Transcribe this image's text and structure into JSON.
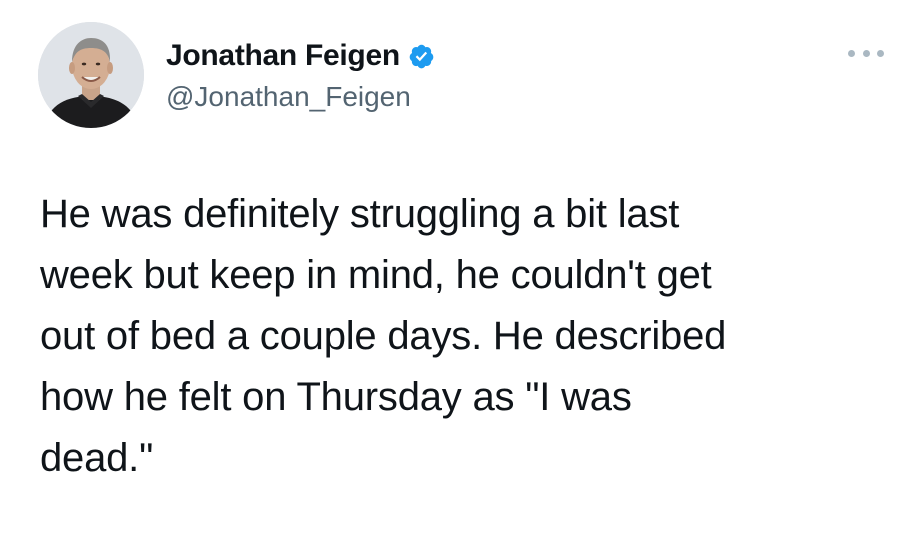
{
  "author": {
    "display_name": "Jonathan Feigen",
    "handle": "@Jonathan_Feigen",
    "verified": true,
    "verified_icon": "verified-badge-icon",
    "avatar_icon": "profile-photo"
  },
  "actions": {
    "more_icon": "more-options-icon"
  },
  "tweet": {
    "lines": [
      "He was definitely struggling a bit last",
      "week but keep in mind, he couldn't get",
      "out of bed a couple days. He described",
      "how he felt on Thursday as \"I was",
      "dead.\""
    ]
  },
  "colors": {
    "verified_blue": "#1d9bf0",
    "text": "#0f1419",
    "handle_gray": "#536471"
  }
}
